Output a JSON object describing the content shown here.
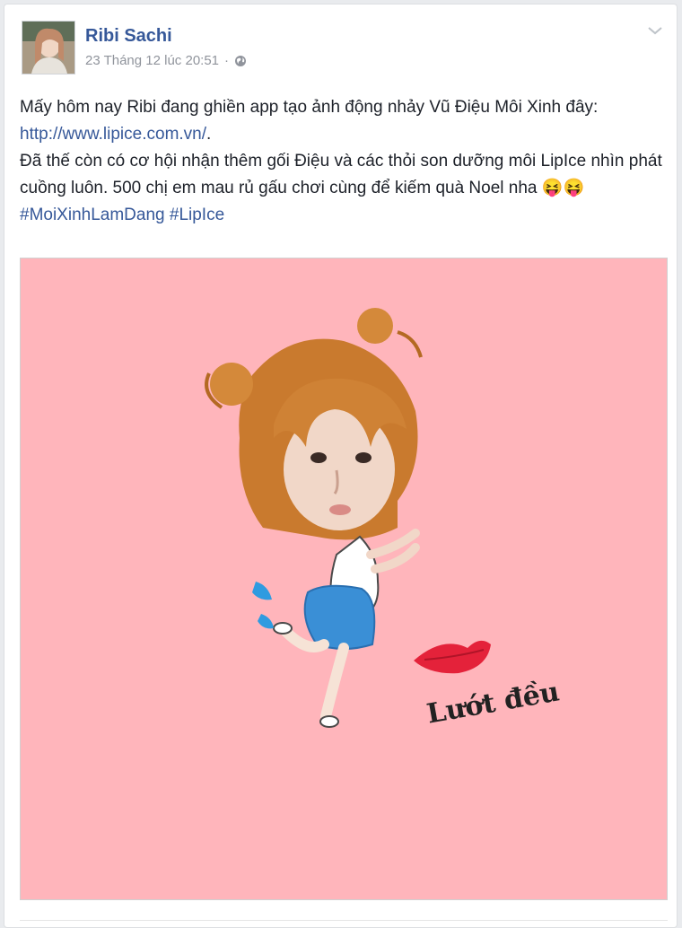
{
  "post": {
    "author": "Ribi Sachi",
    "timestamp": "23 Tháng 12 lúc 20:51",
    "separator": "·",
    "privacy_icon": "globe-icon",
    "menu_icon": "chevron-down-icon",
    "text_line1": "Mấy hôm nay Ribi đang ghiền app tạo ảnh động nhảy Vũ Điệu Môi Xinh đây:",
    "link": "http://www.lipice.com.vn/",
    "link_suffix": ".",
    "text_line2": "Đã thế còn có cơ hội nhận thêm gối Điệu và các thỏi son dưỡng môi LipIce nhìn phát cuồng luôn. 500 chị em mau rủ gấu chơi cùng để kiếm quà Noel nha",
    "emoji": "😝😝",
    "hashtag1": "#MoiXinhLamDang",
    "hashtag2": "#LipIce"
  },
  "media": {
    "caption": "Lướt đều",
    "background_color": "#ffb5bb",
    "accent_color": "#e4223a"
  },
  "colors": {
    "link": "#365899",
    "meta": "#90949c",
    "text": "#1d2129"
  }
}
